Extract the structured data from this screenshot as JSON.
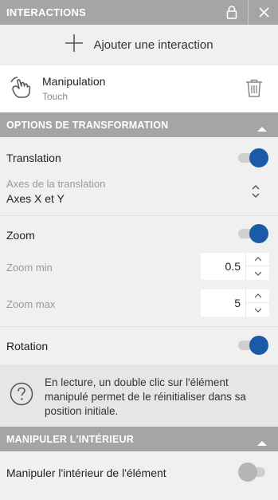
{
  "header": {
    "title": "INTERACTIONS",
    "lock_icon": "lock-icon",
    "close_icon": "close-icon"
  },
  "add_interaction": {
    "label": "Ajouter une interaction",
    "icon": "plus-icon"
  },
  "interaction": {
    "name": "Manipulation",
    "type": "Touch",
    "icon": "touch-hand-icon",
    "delete_icon": "trash-icon"
  },
  "transform_section": {
    "title": "OPTIONS DE TRANSFORMATION",
    "translation": {
      "label": "Translation",
      "enabled": true
    },
    "axes": {
      "label": "Axes de la translation",
      "value": "Axes X et Y"
    },
    "zoom": {
      "label": "Zoom",
      "enabled": true
    },
    "zoom_min": {
      "label": "Zoom min",
      "value": "0.5"
    },
    "zoom_max": {
      "label": "Zoom max",
      "value": "5"
    },
    "rotation": {
      "label": "Rotation",
      "enabled": true
    },
    "info_text": "En lecture, un double clic sur l'élément manipulé permet de le réinitialiser dans sa position initiale."
  },
  "inner_section": {
    "title": "MANIPULER L'INTÉRIEUR",
    "manipulate_inner": {
      "label": "Manipuler l'intérieur de l'élément",
      "enabled": false
    }
  },
  "colors": {
    "accent": "#1b5aa8",
    "header_bg": "#a5a5a5",
    "panel_bg": "#f0f0f0"
  }
}
